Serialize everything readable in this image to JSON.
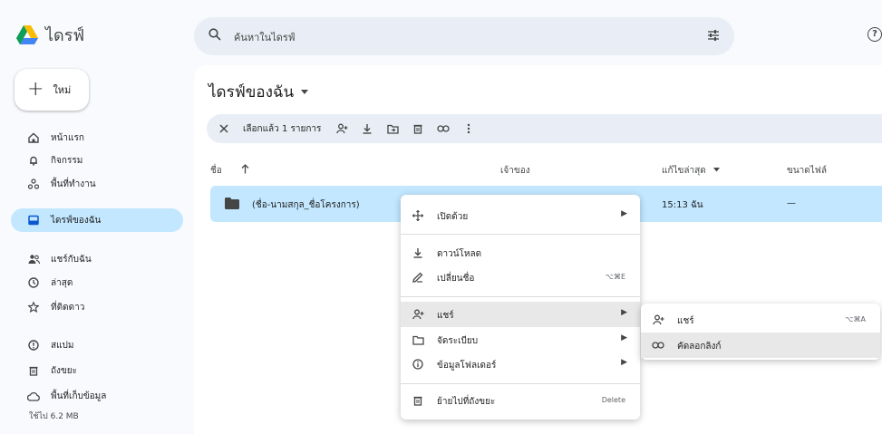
{
  "app": {
    "name": "ไดรฟ์"
  },
  "search": {
    "placeholder": "ค้นหาในไดรฟ์",
    "tune_icon": "tune-icon"
  },
  "sidebar": {
    "new_label": "ใหม่",
    "items": [
      {
        "label": "หน้าแรก",
        "icon": "home-icon"
      },
      {
        "label": "กิจกรรม",
        "icon": "bell-icon"
      },
      {
        "label": "พื้นที่ทำงาน",
        "icon": "workspace-icon"
      },
      {
        "label": "ไดรฟ์ของฉัน",
        "icon": "drive-icon",
        "active": true
      },
      {
        "label": "แชร์กับฉัน",
        "icon": "people-icon"
      },
      {
        "label": "ล่าสุด",
        "icon": "clock-icon"
      },
      {
        "label": "ที่ติดดาว",
        "icon": "star-icon"
      },
      {
        "label": "สแปม",
        "icon": "spam-icon"
      },
      {
        "label": "ถังขยะ",
        "icon": "trash-icon"
      },
      {
        "label": "พื้นที่เก็บข้อมูล",
        "icon": "cloud-icon"
      }
    ],
    "storage_used": "ใช้ไป 6.2 MB"
  },
  "main": {
    "title": "ไดรฟ์ของฉัน",
    "actionbar": {
      "selected": "เลือกแล้ว 1 รายการ"
    },
    "columns": {
      "name": "ชื่อ",
      "owner": "เจ้าของ",
      "modified": "แก้ไขล่าสุด",
      "size": "ขนาดไฟล์"
    },
    "row": {
      "name": "(ชื่อ-นามสกุล_ชื่อโครงการ)",
      "modified": "15:13 ฉัน",
      "size": "—"
    }
  },
  "context_menu": {
    "open_with": "เปิดด้วย",
    "download": "ดาวน์โหลด",
    "rename": "เปลี่ยนชื่อ",
    "rename_shortcut": "⌥⌘E",
    "share": "แชร์",
    "organize": "จัดระเบียบ",
    "folder_info": "ข้อมูลโฟลเดอร์",
    "move_to_trash": "ย้ายไปที่ถังขยะ",
    "trash_shortcut": "Delete"
  },
  "share_submenu": {
    "share": "แชร์",
    "share_shortcut": "⌥⌘A",
    "copy_link": "คัดลอกลิงก์"
  },
  "colors": {
    "accent": "#c2e7ff",
    "searchbg": "#e9eef6"
  }
}
